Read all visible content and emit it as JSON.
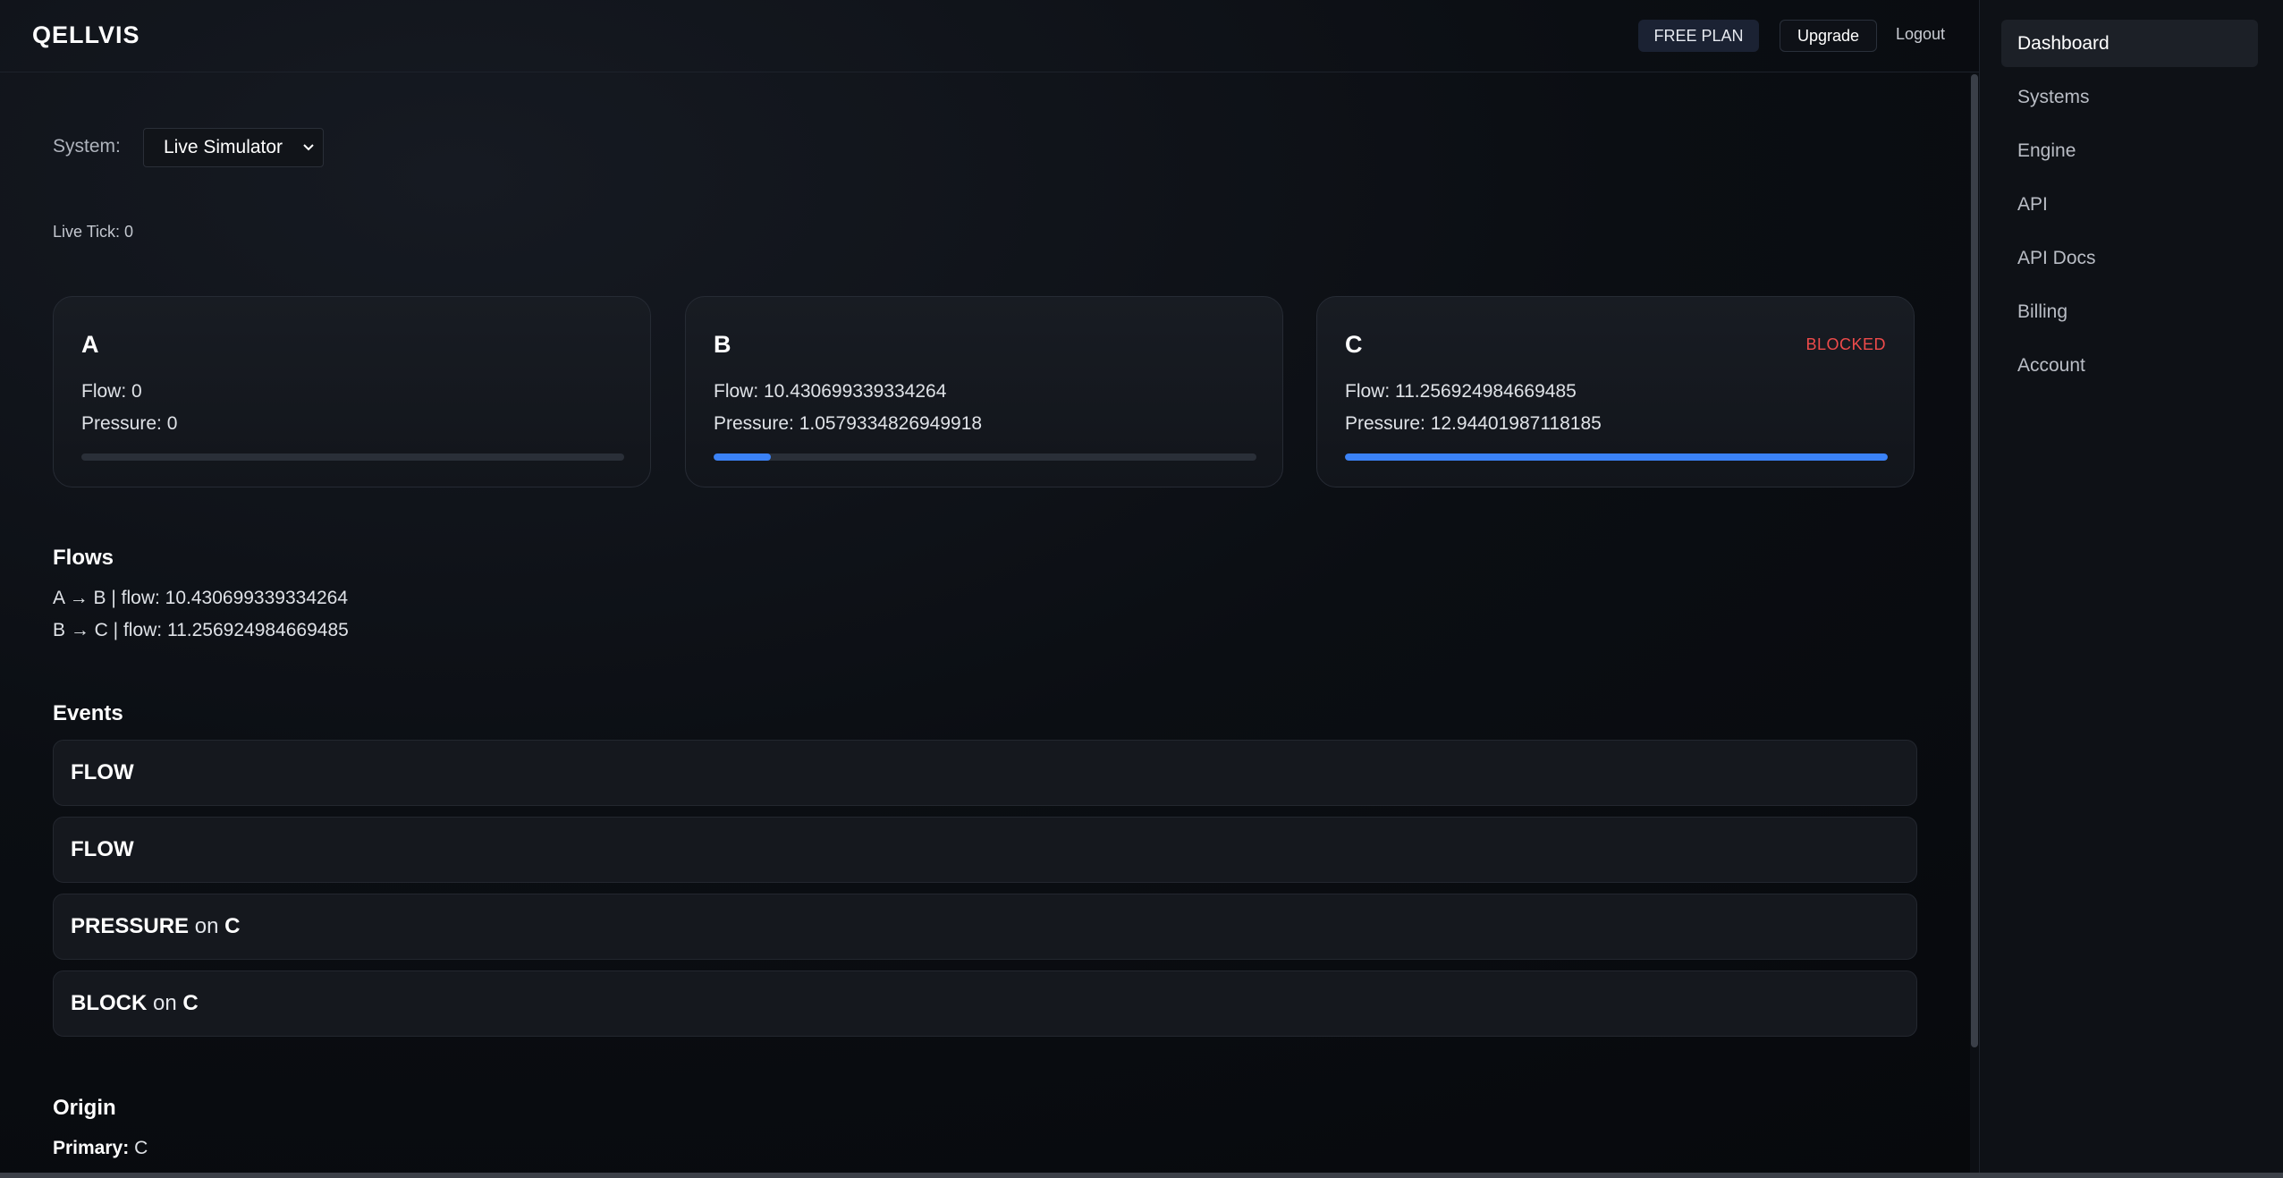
{
  "app": {
    "logo": "QELLVIS",
    "plan_badge": "FREE PLAN",
    "upgrade_label": "Upgrade",
    "logout_label": "Logout"
  },
  "system": {
    "label": "System:",
    "selected": "Live Simulator",
    "live_tick": "Live Tick: 0"
  },
  "nodes": [
    {
      "name": "A",
      "flow": "Flow: 0",
      "pressure": "Pressure: 0",
      "badge": "",
      "level": 0.0
    },
    {
      "name": "B",
      "flow": "Flow: 10.430699339334264",
      "pressure": "Pressure: 1.0579334826949918",
      "badge": "",
      "level": 0.106
    },
    {
      "name": "C",
      "flow": "Flow: 11.256924984669485",
      "pressure": "Pressure: 12.94401987118185",
      "badge": "BLOCKED",
      "level": 1.0
    }
  ],
  "flows": {
    "title": "Flows",
    "items": [
      "A → B | flow: 10.430699339334264",
      "B → C | flow: 11.256924984669485"
    ]
  },
  "events": {
    "title": "Events",
    "items": [
      {
        "type": "FLOW",
        "on": "",
        "node": ""
      },
      {
        "type": "FLOW",
        "on": "",
        "node": ""
      },
      {
        "type": "PRESSURE",
        "on": "on",
        "node": "C"
      },
      {
        "type": "BLOCK",
        "on": "on",
        "node": "C"
      }
    ]
  },
  "origin": {
    "title": "Origin",
    "primary_label": "Primary:",
    "primary_value": "C"
  },
  "sidebar": {
    "items": [
      {
        "label": "Dashboard",
        "active": true
      },
      {
        "label": "Systems",
        "active": false
      },
      {
        "label": "Engine",
        "active": false
      },
      {
        "label": "API",
        "active": false
      },
      {
        "label": "API Docs",
        "active": false
      },
      {
        "label": "Billing",
        "active": false
      },
      {
        "label": "Account",
        "active": false
      }
    ]
  },
  "colors": {
    "accent": "#3b82f6",
    "blocked": "#ef4b4b",
    "background": "#07090d",
    "card": "#15181e"
  }
}
